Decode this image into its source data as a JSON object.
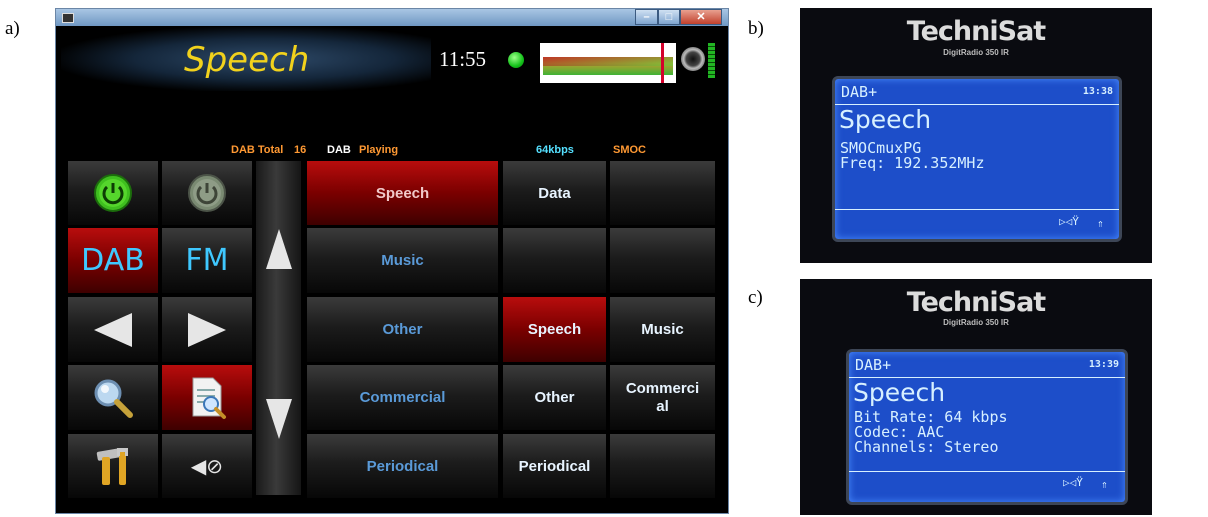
{
  "labels": {
    "a": "a)",
    "b": "b)",
    "c": "c)"
  },
  "window": {
    "title": "Speech",
    "clock": "11:55",
    "status": {
      "dab_total_label": "DAB Total",
      "dab_total_value": "16",
      "dab": "DAB",
      "playing": "Playing",
      "bitrate": "64kbps",
      "ensemble": "SMOC"
    },
    "controls": {
      "dab": "DAB",
      "fm": "FM",
      "mute": "◀⊘"
    },
    "categories": [
      "Speech",
      "Music",
      "Other",
      "Commercial",
      "Periodical"
    ],
    "grid": {
      "r1": [
        "Data",
        ""
      ],
      "r2": [
        "",
        ""
      ],
      "r3": [
        "Speech",
        "Music"
      ],
      "r4": [
        "Other",
        "Commerci al"
      ],
      "r5": [
        "Periodical",
        ""
      ]
    },
    "colors": {
      "title": "#f2d21c",
      "accent_red": "#9a0000",
      "category_text": "#5a9ad8",
      "status_orange": "#ff9933",
      "status_cyan": "#55e0ff"
    }
  },
  "photo_b": {
    "brand": "TechniSat",
    "model": "DigitRadio 350 IR",
    "mode": "DAB+",
    "time": "13:38",
    "station": "Speech",
    "lines": [
      "SMOCmuxPG",
      "Freq: 192.352MHz"
    ]
  },
  "photo_c": {
    "brand": "TechniSat",
    "model": "DigitRadio 350 IR",
    "mode": "DAB+",
    "time": "13:39",
    "station": "Speech",
    "lines": [
      "Bit Rate: 64 kbps",
      "Codec: AAC",
      "Channels: Stereo"
    ]
  }
}
